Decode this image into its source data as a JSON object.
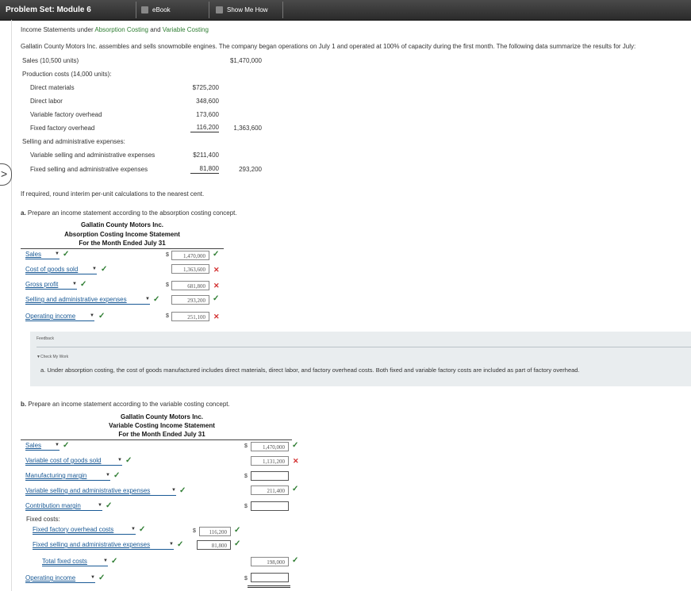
{
  "header": {
    "title": "Problem Set: Module 6",
    "ebook": "eBook",
    "show_me_how": "Show Me How"
  },
  "nav": {
    "prev_arrow": ">"
  },
  "heading": {
    "prefix": "Income Statements under ",
    "link1": "Absorption Costing",
    "and": " and ",
    "link2": "Variable Costing"
  },
  "intro": "Gallatin County Motors Inc. assembles and sells snowmobile engines. The company began operations on July 1 and operated at 100% of capacity during the first month. The following data summarize the results for July:",
  "data_table": {
    "sales_label": "Sales (10,500 units)",
    "sales_value": "$1,470,000",
    "prod_label": "Production costs (14,000 units):",
    "dm_label": "Direct materials",
    "dm_value": "$725,200",
    "dl_label": "Direct labor",
    "dl_value": "348,600",
    "vfo_label": "Variable factory overhead",
    "vfo_value": "173,600",
    "ffo_label": "Fixed factory overhead",
    "ffo_value": "116,200",
    "prod_total": "1,363,600",
    "sa_label": "Selling and administrative expenses:",
    "vsa_label": "Variable selling and administrative expenses",
    "vsa_value": "$211,400",
    "fsa_label": "Fixed selling and administrative expenses",
    "fsa_value": "81,800",
    "sa_total": "293,200"
  },
  "round_note": "If required, round interim per-unit calculations to the nearest cent.",
  "part_a": {
    "prompt_letter": "a.",
    "prompt": "Prepare an income statement according to the absorption costing concept.",
    "company": "Gallatin County Motors Inc.",
    "title": "Absorption Costing Income Statement",
    "period": "For the Month Ended July 31",
    "rows": [
      {
        "label": "Sales",
        "value": "1,470,000",
        "correct": "✓"
      },
      {
        "label": "Cost of goods sold",
        "value": "1,363,600",
        "correct": "✕"
      },
      {
        "label": "Gross profit",
        "value": "681,800",
        "correct": "✕"
      },
      {
        "label": "Selling and administrative expenses",
        "value": "293,200",
        "correct": "✓"
      },
      {
        "label": "Operating income",
        "value": "251,100",
        "correct": "✕"
      }
    ]
  },
  "feedback": {
    "label": "Feedback",
    "check_my_work": "Check My Work",
    "text": "a. Under absorption costing, the cost of goods manufactured includes direct materials, direct labor, and factory overhead costs. Both fixed and variable factory costs are included as part of factory overhead."
  },
  "part_b": {
    "prompt_letter": "b.",
    "prompt": "Prepare an income statement according to the variable costing concept.",
    "company": "Gallatin County Motors Inc.",
    "title": "Variable Costing Income Statement",
    "period": "For the Month Ended July 31",
    "sales": {
      "label": "Sales",
      "value": "1,470,000"
    },
    "vcogs": {
      "label": "Variable cost of goods sold",
      "value": "1,131,200"
    },
    "mfg_margin": {
      "label": "Manufacturing margin",
      "value": ""
    },
    "vsa": {
      "label": "Variable selling and administrative expenses",
      "value": "211,400"
    },
    "contrib": {
      "label": "Contribution margin",
      "value": ""
    },
    "fixed_costs_label": "Fixed costs:",
    "ffo": {
      "label": "Fixed factory overhead costs",
      "value": "116,200"
    },
    "fsa": {
      "label": "Fixed selling and administrative expenses",
      "value": "81,800"
    },
    "total_fixed": {
      "label": "Total fixed costs",
      "value": "198,000"
    },
    "op_income": {
      "label": "Operating income",
      "value": ""
    }
  },
  "symbols": {
    "dollar": "$",
    "check": "✓",
    "cross": "✕",
    "dropdown": "▼",
    "collapse": "▼"
  }
}
